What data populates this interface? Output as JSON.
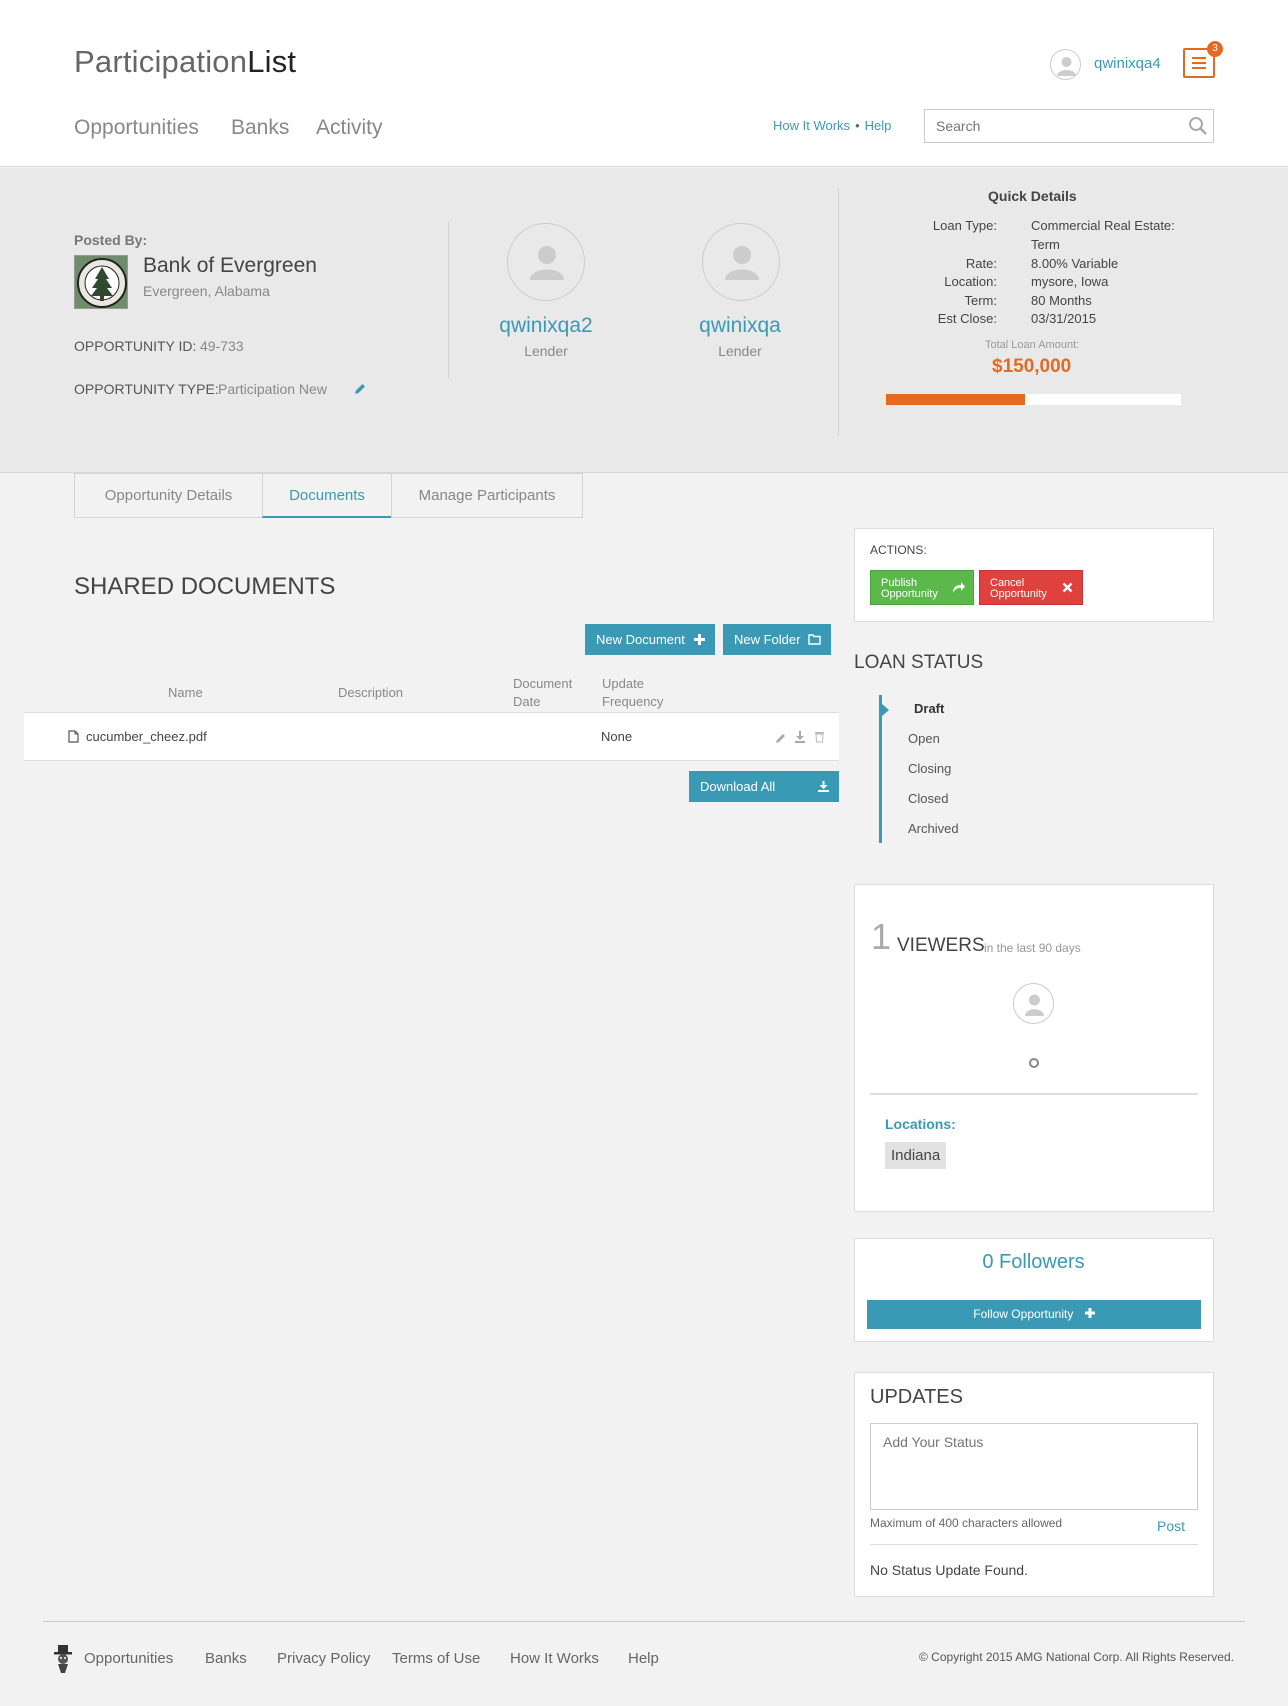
{
  "header": {
    "logo_part1": "Participation",
    "logo_part2": "List",
    "nav": [
      "Opportunities",
      "Banks",
      "Activity"
    ],
    "username": "qwinixqa4",
    "notifications": "3",
    "how_it_works": "How It Works",
    "dot": "•",
    "help": "Help",
    "search_placeholder": "Search"
  },
  "banner": {
    "posted_by_label": "Posted By:",
    "bank_name": "Bank of Evergreen",
    "bank_location": "Evergreen, Alabama",
    "opp_id_label": "OPPORTUNITY ID:",
    "opp_id": "49-733",
    "opp_type_label": "OPPORTUNITY TYPE:",
    "opp_type": "Participation New",
    "lenders": [
      {
        "name": "qwinixqa2",
        "role": "Lender"
      },
      {
        "name": "qwinixqa",
        "role": "Lender"
      }
    ],
    "quick_details": {
      "title": "Quick Details",
      "loan_type_label": "Loan Type:",
      "loan_type_1": "Commercial Real Estate:",
      "loan_type_2": "Term",
      "rate_label": "Rate:",
      "rate": "8.00% Variable",
      "location_label": "Location:",
      "location": "mysore, Iowa",
      "term_label": "Term:",
      "term": "80 Months",
      "est_close_label": "Est Close:",
      "est_close": "03/31/2015",
      "total_label": "Total Loan Amount:",
      "total": "$150,000",
      "progress_fraction": 0.47
    }
  },
  "tabs": [
    "Opportunity Details",
    "Documents",
    "Manage Participants"
  ],
  "documents": {
    "title": "SHARED DOCUMENTS",
    "new_document": "New Document",
    "new_folder": "New Folder",
    "col_name": "Name",
    "col_description": "Description",
    "col_date_1": "Document",
    "col_date_2": "Date",
    "col_freq_1": "Update",
    "col_freq_2": "Frequency",
    "rows": [
      {
        "name": "cucumber_cheez.pdf",
        "description": "",
        "date": "",
        "frequency": "None"
      }
    ],
    "download_all": "Download All"
  },
  "actions": {
    "label": "ACTIONS:",
    "publish_1": "Publish",
    "publish_2": "Opportunity",
    "cancel_1": "Cancel",
    "cancel_2": "Opportunity"
  },
  "loan_status": {
    "title": "LOAN STATUS",
    "items": [
      "Draft",
      "Open",
      "Closing",
      "Closed",
      "Archived"
    ],
    "current": "Draft"
  },
  "viewers": {
    "count": "1",
    "label": "VIEWERS",
    "sub": "in the last 90 days",
    "locations_label": "Locations:",
    "locations": [
      "Indiana"
    ]
  },
  "followers": {
    "text": "0 Followers",
    "button": "Follow Opportunity"
  },
  "updates": {
    "title": "UPDATES",
    "placeholder": "Add Your Status",
    "max_chars": "Maximum of 400 characters allowed",
    "post": "Post",
    "no_status": "No Status Update Found."
  },
  "footer": {
    "links": [
      "Opportunities",
      "Banks",
      "Privacy Policy",
      "Terms of Use",
      "How It Works",
      "Help"
    ],
    "copyright": "© Copyright 2015 AMG National Corp. All Rights Reserved."
  },
  "colors": {
    "accent": "#3a9ab5",
    "orange": "#e46a22",
    "green": "#5ab94a",
    "red": "#e0413f"
  }
}
